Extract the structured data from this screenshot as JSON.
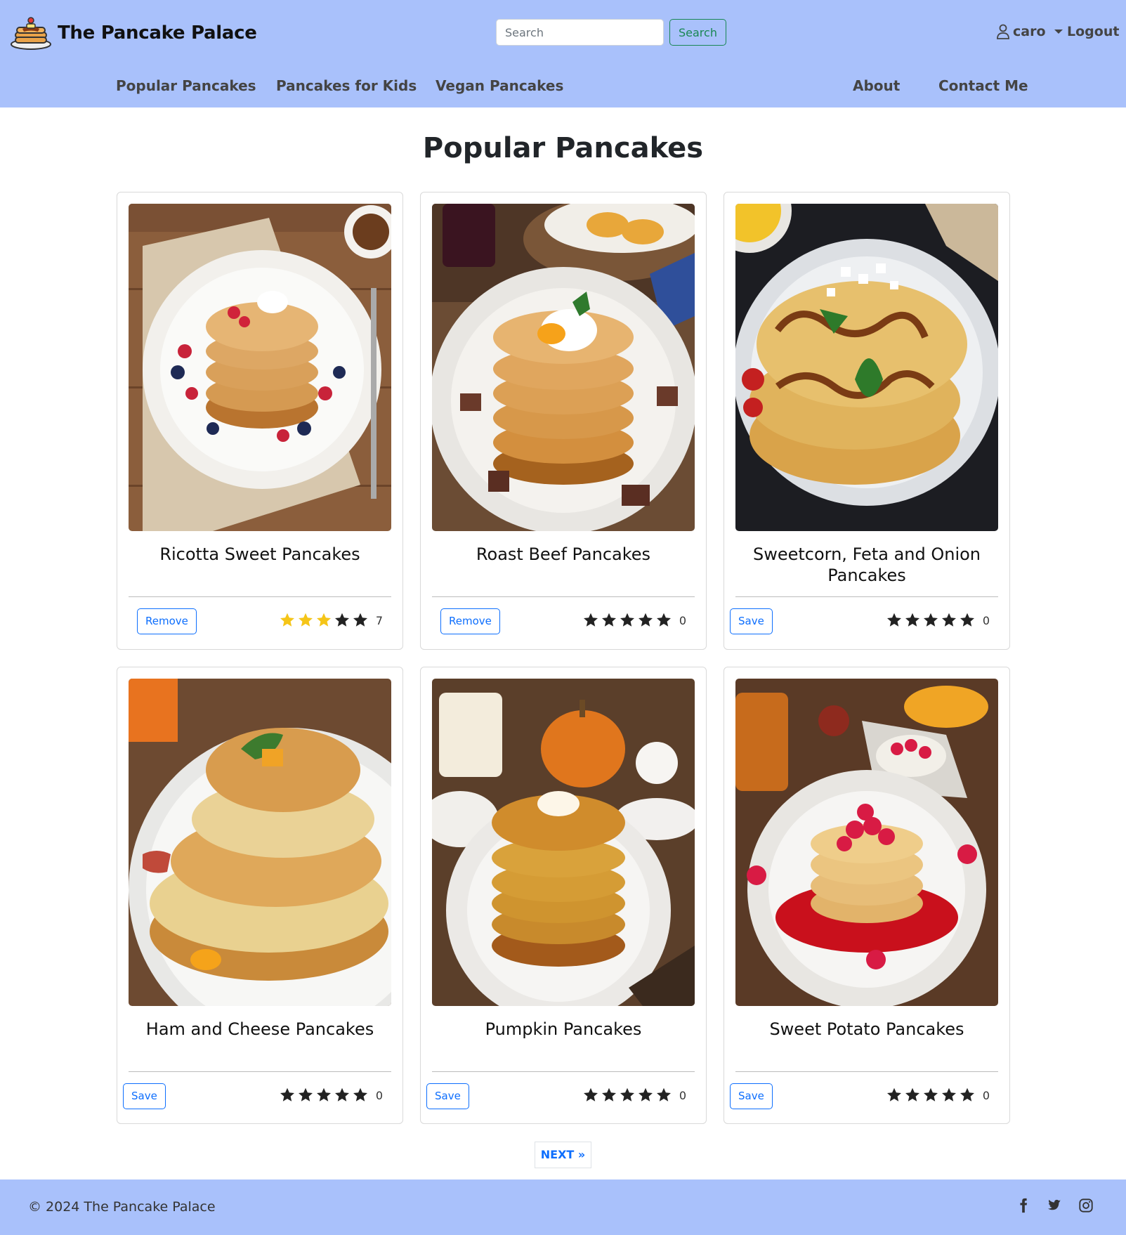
{
  "header": {
    "brand": "The Pancake Palace",
    "search_placeholder": "Search",
    "search_button": "Search",
    "user": "caro",
    "logout": "Logout"
  },
  "nav": {
    "popular": "Popular Pancakes",
    "kids": "Pancakes for Kids",
    "vegan": "Vegan Pancakes",
    "about": "About",
    "contact": "Contact Me"
  },
  "page_title": "Popular Pancakes",
  "cards": [
    {
      "title": "Ricotta Sweet Pancakes",
      "button": "Remove",
      "rating": 3,
      "count": "7"
    },
    {
      "title": "Roast Beef Pancakes",
      "button": "Remove",
      "rating": 0,
      "count": "0"
    },
    {
      "title": "Sweetcorn, Feta and Onion Pancakes",
      "button": "Save",
      "rating": 0,
      "count": "0"
    },
    {
      "title": "Ham and Cheese Pancakes",
      "button": "Save",
      "rating": 0,
      "count": "0"
    },
    {
      "title": "Pumpkin Pancakes",
      "button": "Save",
      "rating": 0,
      "count": "0"
    },
    {
      "title": "Sweet Potato Pancakes",
      "button": "Save",
      "rating": 0,
      "count": "0"
    }
  ],
  "pagination": {
    "next": "NEXT »"
  },
  "footer": {
    "copyright": "© 2024 The Pancake Palace"
  },
  "colors": {
    "header_bg": "#a9c1fb",
    "star_active": "#f5c518",
    "star_inactive": "#222222",
    "link": "#0d6efd",
    "search_green": "#198754"
  }
}
